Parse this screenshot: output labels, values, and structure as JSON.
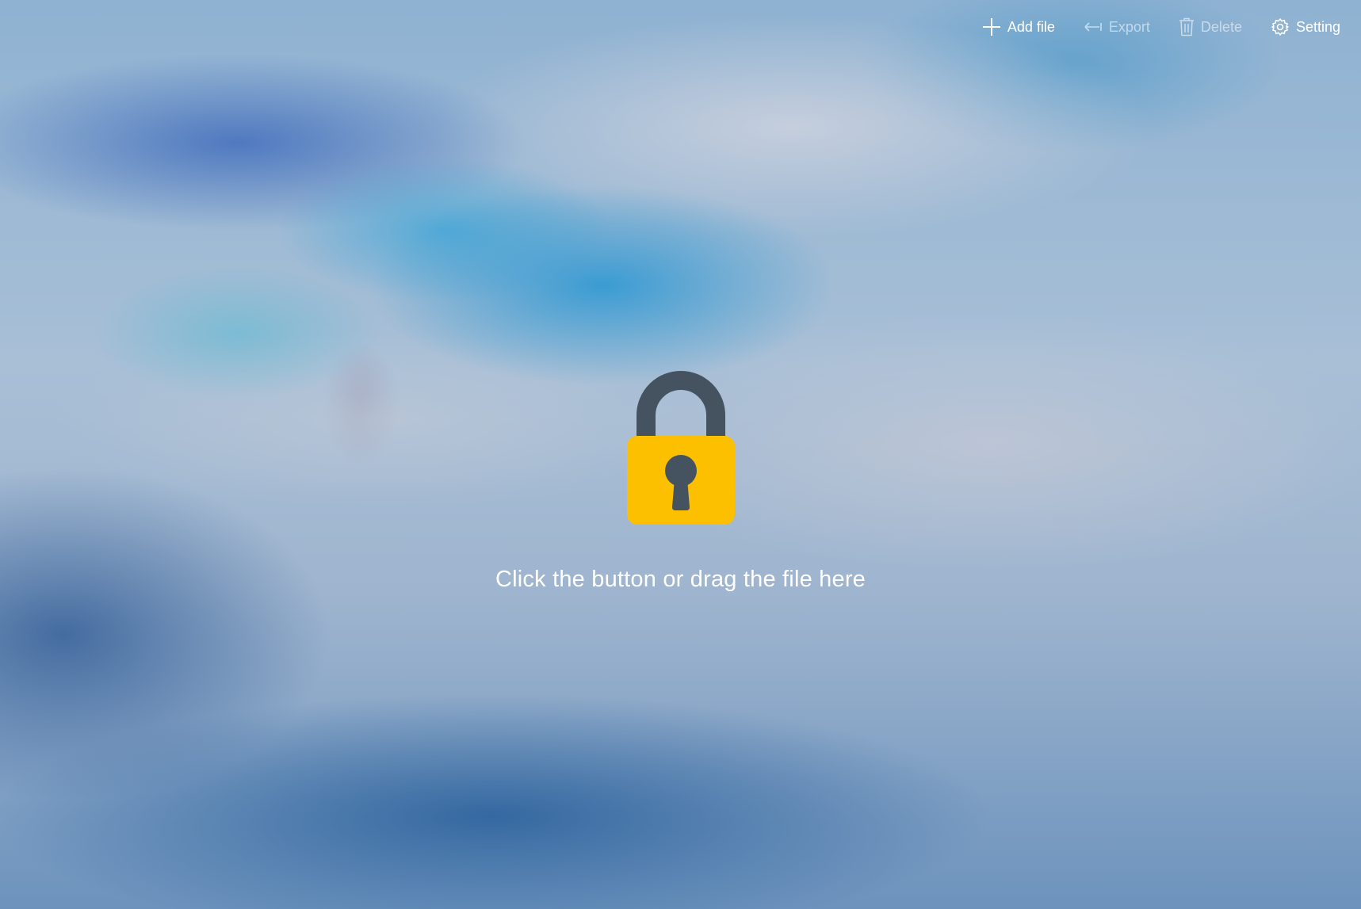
{
  "toolbar": {
    "add_file": {
      "label": "Add file",
      "icon": "plus-icon",
      "enabled": true
    },
    "export": {
      "label": "Export",
      "icon": "arrow-left-icon",
      "enabled": false
    },
    "delete": {
      "label": "Delete",
      "icon": "trash-icon",
      "enabled": false
    },
    "setting": {
      "label": "Setting",
      "icon": "gear-icon",
      "enabled": true
    }
  },
  "drop_zone": {
    "icon": "padlock-icon",
    "hint": "Click the button or drag the file here"
  },
  "colors": {
    "lock_body": "#FDC000",
    "lock_shackle": "#44535F",
    "keyhole": "#44535F",
    "text": "#FFFFFF"
  }
}
